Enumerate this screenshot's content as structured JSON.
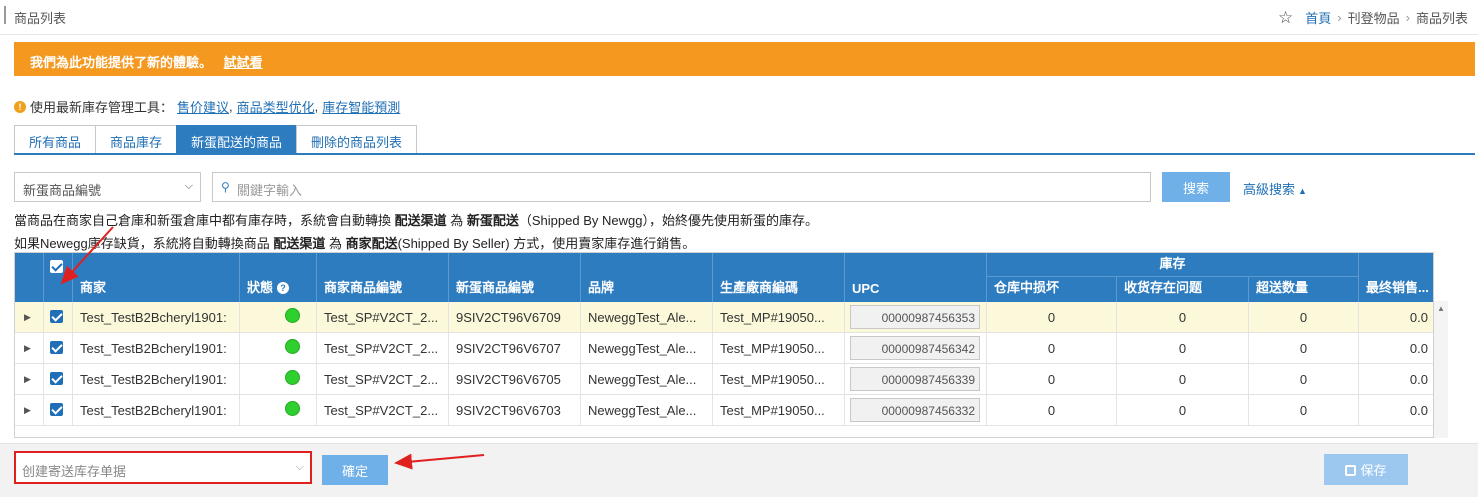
{
  "header": {
    "title": "商品列表",
    "breadcrumbs": [
      "首頁",
      "刊登物品",
      "商品列表"
    ]
  },
  "banner": {
    "text": "我們為此功能提供了新的體驗。",
    "link": "試試看"
  },
  "tools": {
    "label": "使用最新庫存管理工具：",
    "links": [
      "售价建议",
      "商品类型优化",
      "庫存智能預測"
    ]
  },
  "tabs": [
    {
      "label": "所有商品",
      "active": false
    },
    {
      "label": "商品庫存",
      "active": false
    },
    {
      "label": "新蛋配送的商品",
      "active": true
    },
    {
      "label": "刪除的商品列表",
      "active": false
    }
  ],
  "search": {
    "field_select": "新蛋商品編號",
    "placeholder": "關鍵字輸入",
    "button": "搜索",
    "advanced": "高級搜索"
  },
  "notes": {
    "line1": {
      "a": "當商品在商家自己倉庫和新蛋倉庫中都有庫存時，系統會自動轉換 ",
      "b": "配送渠道",
      "c": " 為 ",
      "d": "新蛋配送",
      "e": "（Shipped By Newgg），始終優先使用新蛋的庫存。"
    },
    "line2": {
      "a": "如果Newegg庫存缺貨，系統將自動轉換商品 ",
      "b": "配送渠道",
      "c": " 為 ",
      "d": "商家配送",
      "e": "(Shipped By Seller) 方式，使用賣家庫存進行銷售。"
    }
  },
  "grid": {
    "headers": {
      "seller": "商家",
      "status": "狀態",
      "seller_part": "商家商品編號",
      "newegg_item": "新蛋商品編號",
      "brand": "品牌",
      "mfr": "生產廠商編碼",
      "upc": "UPC",
      "inventory_group": "庫存",
      "damaged": "仓库中损坏",
      "receiving": "收货存在问题",
      "over": "超送数量",
      "last": "最终销售..."
    },
    "rows": [
      {
        "seller": "Test_TestB2Bcheryl1901:",
        "seller_part": "Test_SP#V2CT_2...",
        "newegg_item": "9SIV2CT96V6709",
        "brand": "NeweggTest_Ale...",
        "mfr": "Test_MP#19050...",
        "upc": "00000987456353",
        "damaged": "0",
        "receiving": "0",
        "over": "0",
        "last": "0.0"
      },
      {
        "seller": "Test_TestB2Bcheryl1901:",
        "seller_part": "Test_SP#V2CT_2...",
        "newegg_item": "9SIV2CT96V6707",
        "brand": "NeweggTest_Ale...",
        "mfr": "Test_MP#19050...",
        "upc": "00000987456342",
        "damaged": "0",
        "receiving": "0",
        "over": "0",
        "last": "0.0"
      },
      {
        "seller": "Test_TestB2Bcheryl1901:",
        "seller_part": "Test_SP#V2CT_2...",
        "newegg_item": "9SIV2CT96V6705",
        "brand": "NeweggTest_Ale...",
        "mfr": "Test_MP#19050...",
        "upc": "00000987456339",
        "damaged": "0",
        "receiving": "0",
        "over": "0",
        "last": "0.0"
      },
      {
        "seller": "Test_TestB2Bcheryl1901:",
        "seller_part": "Test_SP#V2CT_2...",
        "newegg_item": "9SIV2CT96V6703",
        "brand": "NeweggTest_Ale...",
        "mfr": "Test_MP#19050...",
        "upc": "00000987456332",
        "damaged": "0",
        "receiving": "0",
        "over": "0",
        "last": "0.0"
      }
    ]
  },
  "footer": {
    "action_select": "创建寄送库存单据",
    "confirm": "確定",
    "save": "保存"
  },
  "colors": {
    "accent": "#2e7cc0",
    "banner": "#f5981f",
    "status_ok": "#2fcf2f",
    "annotation": "#e0201f"
  },
  "icons": {
    "star": "star-icon",
    "info": "info-icon",
    "search": "search-icon",
    "help": "question-icon",
    "save": "floppy-disk-icon"
  }
}
